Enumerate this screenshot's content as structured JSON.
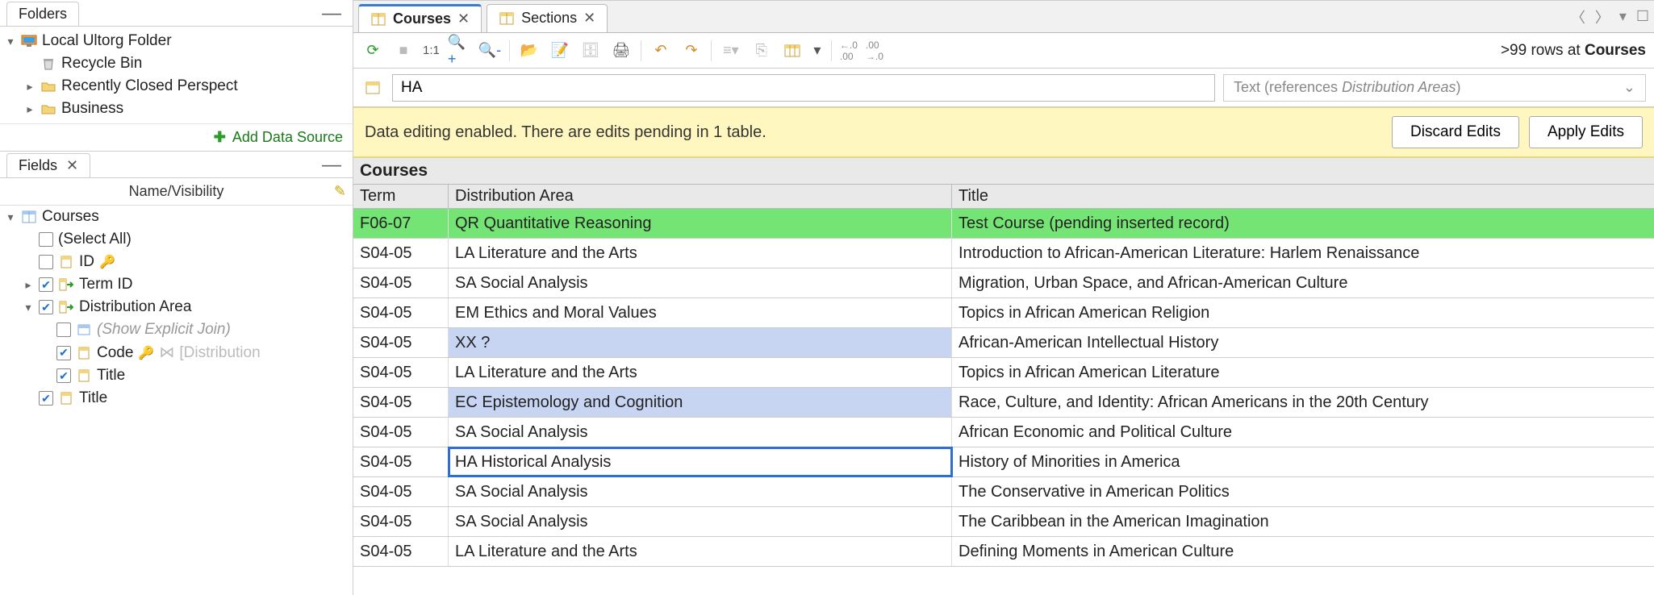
{
  "folders": {
    "panel_label": "Folders",
    "root": "Local Ultorg Folder",
    "items": [
      "Recycle Bin",
      "Recently Closed Perspect",
      "Business"
    ],
    "add_label": "Add Data Source"
  },
  "fields": {
    "panel_label": "Fields",
    "name_vis": "Name/Visibility",
    "root": "Courses",
    "select_all": "(Select All)",
    "id": "ID",
    "term_id": "Term ID",
    "dist_area": "Distribution Area",
    "show_join": "(Show Explicit Join)",
    "code": "Code",
    "code_ref": "[Distribution",
    "title_field": "Title",
    "outer_title": "Title"
  },
  "tabs": {
    "courses": "Courses",
    "sections": "Sections"
  },
  "toolbar": {
    "ratio": "1:1"
  },
  "row_info": {
    "prefix": ">99 rows at ",
    "target": "Courses"
  },
  "editor": {
    "value": "HA",
    "type_hint": "Text (references Distribution Areas)"
  },
  "banner": {
    "text": "Data editing enabled. There are edits pending in 1 table.",
    "discard": "Discard Edits",
    "apply": "Apply Edits"
  },
  "grid": {
    "title": "Courses",
    "headers": {
      "term": "Term",
      "dist": "Distribution Area",
      "title": "Title"
    },
    "rows": [
      {
        "term": "F06-07",
        "dist": "QR Quantitative Reasoning",
        "title": "Test Course (pending inserted record)",
        "cls": "ins"
      },
      {
        "term": "S04-05",
        "dist": "LA Literature and the Arts",
        "title": "Introduction to African-American Literature: Harlem Renaissance",
        "cls": ""
      },
      {
        "term": "S04-05",
        "dist": "SA Social Analysis",
        "title": "Migration, Urban Space, and African-American Culture",
        "cls": ""
      },
      {
        "term": "S04-05",
        "dist": "EM Ethics and Moral Values",
        "title": "Topics in African American Religion",
        "cls": ""
      },
      {
        "term": "S04-05",
        "dist": "XX ?",
        "title": "African-American Intellectual History",
        "cls": "hl"
      },
      {
        "term": "S04-05",
        "dist": "LA Literature and the Arts",
        "title": "Topics in African American Literature",
        "cls": ""
      },
      {
        "term": "S04-05",
        "dist": "EC Epistemology and Cognition",
        "title": "Race, Culture, and Identity: African Americans in the 20th Century",
        "cls": "hl"
      },
      {
        "term": "S04-05",
        "dist": "SA Social Analysis",
        "title": "African Economic and Political Culture",
        "cls": ""
      },
      {
        "term": "S04-05",
        "dist": "HA Historical Analysis",
        "title": "History of Minorities in America",
        "cls": "edit"
      },
      {
        "term": "S04-05",
        "dist": "SA Social Analysis",
        "title": "The Conservative in American Politics",
        "cls": ""
      },
      {
        "term": "S04-05",
        "dist": "SA Social Analysis",
        "title": "The Caribbean in the American Imagination",
        "cls": ""
      },
      {
        "term": "S04-05",
        "dist": "LA Literature and the Arts",
        "title": "Defining Moments in American Culture",
        "cls": ""
      }
    ]
  }
}
